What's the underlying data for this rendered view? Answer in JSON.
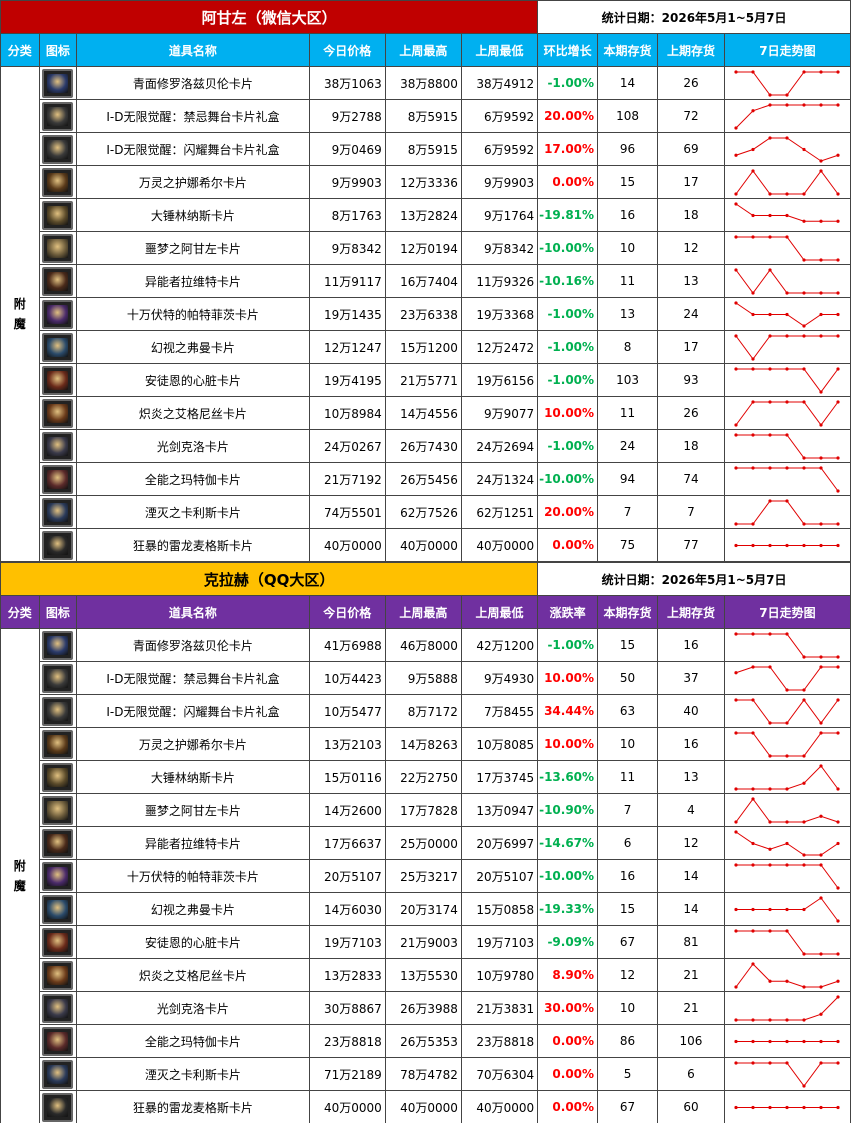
{
  "sections": [
    {
      "title": "阿甘左（微信大区）",
      "date_label": "统计日期：2026年5月1~5月7日",
      "title_color": "#c00000",
      "header_color": "#00b0f0",
      "headers": [
        "分类",
        "图标",
        "道具名称",
        "今日价格",
        "上周最高",
        "上周最低",
        "环比增长",
        "本期存货",
        "上期存货",
        "7日走势图"
      ],
      "category": "附魔",
      "rows": [
        {
          "name": "青面修罗洛兹贝伦卡片",
          "today": "38万1063",
          "high": "38万8800",
          "low": "38万4912",
          "pct": "-1.00%",
          "dir": "down",
          "stock": "14",
          "prev": "26",
          "icon_color": "#2a3a6a",
          "trend": [
            5,
            5,
            1,
            1,
            5,
            5,
            5
          ]
        },
        {
          "name": "I-D无限觉醒：禁忌舞台卡片礼盒",
          "today": "9万2788",
          "high": "8万5915",
          "low": "6万9592",
          "pct": "20.00%",
          "dir": "up",
          "stock": "108",
          "prev": "72",
          "icon_color": "#3a3a3a",
          "trend": [
            1,
            4,
            5,
            5,
            5,
            5,
            5
          ]
        },
        {
          "name": "I-D无限觉醒：闪耀舞台卡片礼盒",
          "today": "9万0469",
          "high": "8万5915",
          "low": "6万9592",
          "pct": "17.00%",
          "dir": "up",
          "stock": "96",
          "prev": "69",
          "icon_color": "#3a3a3a",
          "trend": [
            2,
            3,
            5,
            5,
            3,
            1,
            2
          ]
        },
        {
          "name": "万灵之护娜希尔卡片",
          "today": "9万9903",
          "high": "12万3336",
          "low": "9万9903",
          "pct": "0.00%",
          "dir": "zero",
          "stock": "15",
          "prev": "17",
          "icon_color": "#5a3a1a",
          "trend": [
            1,
            5,
            1,
            1,
            1,
            5,
            1
          ]
        },
        {
          "name": "大锤林纳斯卡片",
          "today": "8万1763",
          "high": "13万2824",
          "low": "9万1764",
          "pct": "-19.81%",
          "dir": "down",
          "stock": "16",
          "prev": "18",
          "icon_color": "#5a4a2a",
          "trend": [
            5,
            3,
            3,
            3,
            2,
            2,
            2
          ]
        },
        {
          "name": "噩梦之阿甘左卡片",
          "today": "9万8342",
          "high": "12万0194",
          "low": "9万8342",
          "pct": "-10.00%",
          "dir": "down",
          "stock": "10",
          "prev": "12",
          "icon_color": "#6a5a3a",
          "trend": [
            5,
            5,
            5,
            5,
            1,
            1,
            1
          ]
        },
        {
          "name": "异能者拉维特卡片",
          "today": "11万9117",
          "high": "16万7404",
          "low": "11万9326",
          "pct": "-10.16%",
          "dir": "down",
          "stock": "11",
          "prev": "13",
          "icon_color": "#4a2a1a",
          "trend": [
            5,
            1,
            5,
            1,
            1,
            1,
            1
          ]
        },
        {
          "name": "十万伏特的帕特菲茨卡片",
          "today": "19万1435",
          "high": "23万6338",
          "low": "19万3368",
          "pct": "-1.00%",
          "dir": "down",
          "stock": "13",
          "prev": "24",
          "icon_color": "#4a2a6a",
          "trend": [
            5,
            3,
            3,
            3,
            1,
            3,
            3
          ]
        },
        {
          "name": "幻视之弗曼卡片",
          "today": "12万1247",
          "high": "15万1200",
          "low": "12万2472",
          "pct": "-1.00%",
          "dir": "down",
          "stock": "8",
          "prev": "17",
          "icon_color": "#2a4a6a",
          "trend": [
            5,
            1,
            5,
            5,
            5,
            5,
            5
          ]
        },
        {
          "name": "安徒恩的心脏卡片",
          "today": "19万4195",
          "high": "21万5771",
          "low": "19万6156",
          "pct": "-1.00%",
          "dir": "down",
          "stock": "103",
          "prev": "93",
          "icon_color": "#6a2a1a",
          "trend": [
            5,
            5,
            5,
            5,
            5,
            1,
            5
          ]
        },
        {
          "name": "炽炎之艾格尼丝卡片",
          "today": "10万8984",
          "high": "14万4556",
          "low": "9万9077",
          "pct": "10.00%",
          "dir": "up",
          "stock": "11",
          "prev": "26",
          "icon_color": "#6a3a1a",
          "trend": [
            1,
            5,
            5,
            5,
            5,
            1,
            5
          ]
        },
        {
          "name": "光剑克洛卡片",
          "today": "24万0267",
          "high": "26万7430",
          "low": "24万2694",
          "pct": "-1.00%",
          "dir": "down",
          "stock": "24",
          "prev": "18",
          "icon_color": "#3a3a4a",
          "trend": [
            5,
            5,
            5,
            5,
            1,
            1,
            1
          ]
        },
        {
          "name": "全能之玛特伽卡片",
          "today": "21万7192",
          "high": "26万5456",
          "low": "24万1324",
          "pct": "-10.00%",
          "dir": "down",
          "stock": "94",
          "prev": "74",
          "icon_color": "#5a2a2a",
          "trend": [
            5,
            5,
            5,
            5,
            5,
            5,
            1
          ]
        },
        {
          "name": "湮灭之卡利斯卡片",
          "today": "74万5501",
          "high": "62万7526",
          "low": "62万1251",
          "pct": "20.00%",
          "dir": "up",
          "stock": "7",
          "prev": "7",
          "icon_color": "#2a3a5a",
          "trend": [
            1,
            1,
            5,
            5,
            1,
            1,
            1
          ]
        },
        {
          "name": "狂暴的雷龙麦格斯卡片",
          "today": "40万0000",
          "high": "40万0000",
          "low": "40万0000",
          "pct": "0.00%",
          "dir": "zero",
          "stock": "75",
          "prev": "77",
          "icon_color": "#2a2a2a",
          "trend": [
            3,
            3,
            3,
            3,
            3,
            3,
            3
          ]
        }
      ]
    },
    {
      "title": "克拉赫（QQ大区）",
      "date_label": "统计日期：2026年5月1~5月7日",
      "title_color": "#ffc000",
      "header_color": "#7030a0",
      "headers": [
        "分类",
        "图标",
        "道具名称",
        "今日价格",
        "上周最高",
        "上周最低",
        "涨跌率",
        "本期存货",
        "上期存货",
        "7日走势图"
      ],
      "category": "附魔",
      "rows": [
        {
          "name": "青面修罗洛兹贝伦卡片",
          "today": "41万6988",
          "high": "46万8000",
          "low": "42万1200",
          "pct": "-1.00%",
          "dir": "down",
          "stock": "15",
          "prev": "16",
          "icon_color": "#2a3a6a",
          "trend": [
            5,
            5,
            5,
            5,
            1,
            1,
            1
          ]
        },
        {
          "name": "I-D无限觉醒：禁忌舞台卡片礼盒",
          "today": "10万4423",
          "high": "9万5888",
          "low": "9万4930",
          "pct": "10.00%",
          "dir": "up",
          "stock": "50",
          "prev": "37",
          "icon_color": "#3a3a3a",
          "trend": [
            4,
            5,
            5,
            1,
            1,
            5,
            5
          ]
        },
        {
          "name": "I-D无限觉醒：闪耀舞台卡片礼盒",
          "today": "10万5477",
          "high": "8万7172",
          "low": "7万8455",
          "pct": "34.44%",
          "dir": "up",
          "stock": "63",
          "prev": "40",
          "icon_color": "#3a3a3a",
          "trend": [
            5,
            5,
            1,
            1,
            5,
            1,
            5
          ]
        },
        {
          "name": "万灵之护娜希尔卡片",
          "today": "13万2103",
          "high": "14万8263",
          "low": "10万8085",
          "pct": "10.00%",
          "dir": "up",
          "stock": "10",
          "prev": "16",
          "icon_color": "#5a3a1a",
          "trend": [
            5,
            5,
            1,
            1,
            1,
            5,
            5
          ]
        },
        {
          "name": "大锤林纳斯卡片",
          "today": "15万0116",
          "high": "22万2750",
          "low": "17万3745",
          "pct": "-13.60%",
          "dir": "down",
          "stock": "11",
          "prev": "13",
          "icon_color": "#5a4a2a",
          "trend": [
            1,
            1,
            1,
            1,
            2,
            5,
            1
          ]
        },
        {
          "name": "噩梦之阿甘左卡片",
          "today": "14万2600",
          "high": "17万7828",
          "low": "13万0947",
          "pct": "-10.90%",
          "dir": "down",
          "stock": "7",
          "prev": "4",
          "icon_color": "#6a5a3a",
          "trend": [
            1,
            5,
            1,
            1,
            1,
            2,
            1
          ]
        },
        {
          "name": "异能者拉维特卡片",
          "today": "17万6637",
          "high": "25万0000",
          "low": "20万6997",
          "pct": "-14.67%",
          "dir": "down",
          "stock": "6",
          "prev": "12",
          "icon_color": "#4a2a1a",
          "trend": [
            5,
            3,
            2,
            3,
            1,
            1,
            3
          ]
        },
        {
          "name": "十万伏特的帕特菲茨卡片",
          "today": "20万5107",
          "high": "25万3217",
          "low": "20万5107",
          "pct": "-10.00%",
          "dir": "down",
          "stock": "16",
          "prev": "14",
          "icon_color": "#4a2a6a",
          "trend": [
            5,
            5,
            5,
            5,
            5,
            5,
            1
          ]
        },
        {
          "name": "幻视之弗曼卡片",
          "today": "14万6030",
          "high": "20万3174",
          "low": "15万0858",
          "pct": "-19.33%",
          "dir": "down",
          "stock": "15",
          "prev": "14",
          "icon_color": "#2a4a6a",
          "trend": [
            3,
            3,
            3,
            3,
            3,
            5,
            1
          ]
        },
        {
          "name": "安徒恩的心脏卡片",
          "today": "19万7103",
          "high": "21万9003",
          "low": "19万7103",
          "pct": "-9.09%",
          "dir": "down",
          "stock": "67",
          "prev": "81",
          "icon_color": "#6a2a1a",
          "trend": [
            5,
            5,
            5,
            5,
            1,
            1,
            1
          ]
        },
        {
          "name": "炽炎之艾格尼丝卡片",
          "today": "13万2833",
          "high": "13万5530",
          "low": "10万9780",
          "pct": "8.90%",
          "dir": "up",
          "stock": "12",
          "prev": "21",
          "icon_color": "#6a3a1a",
          "trend": [
            1,
            5,
            2,
            2,
            1,
            1,
            2
          ]
        },
        {
          "name": "光剑克洛卡片",
          "today": "30万8867",
          "high": "26万3988",
          "low": "21万3831",
          "pct": "30.00%",
          "dir": "up",
          "stock": "10",
          "prev": "21",
          "icon_color": "#3a3a4a",
          "trend": [
            1,
            1,
            1,
            1,
            1,
            2,
            5
          ]
        },
        {
          "name": "全能之玛特伽卡片",
          "today": "23万8818",
          "high": "26万5353",
          "low": "23万8818",
          "pct": "0.00%",
          "dir": "zero",
          "stock": "86",
          "prev": "106",
          "icon_color": "#5a2a2a",
          "trend": [
            3,
            3,
            3,
            3,
            3,
            3,
            3
          ]
        },
        {
          "name": "湮灭之卡利斯卡片",
          "today": "71万2189",
          "high": "78万4782",
          "low": "70万6304",
          "pct": "0.00%",
          "dir": "zero",
          "stock": "5",
          "prev": "6",
          "icon_color": "#2a3a5a",
          "trend": [
            5,
            5,
            5,
            5,
            1,
            5,
            5
          ]
        },
        {
          "name": "狂暴的雷龙麦格斯卡片",
          "today": "40万0000",
          "high": "40万0000",
          "low": "40万0000",
          "pct": "0.00%",
          "dir": "zero",
          "stock": "67",
          "prev": "60",
          "icon_color": "#2a2a2a",
          "trend": [
            3,
            3,
            3,
            3,
            3,
            3,
            3
          ]
        }
      ]
    }
  ]
}
